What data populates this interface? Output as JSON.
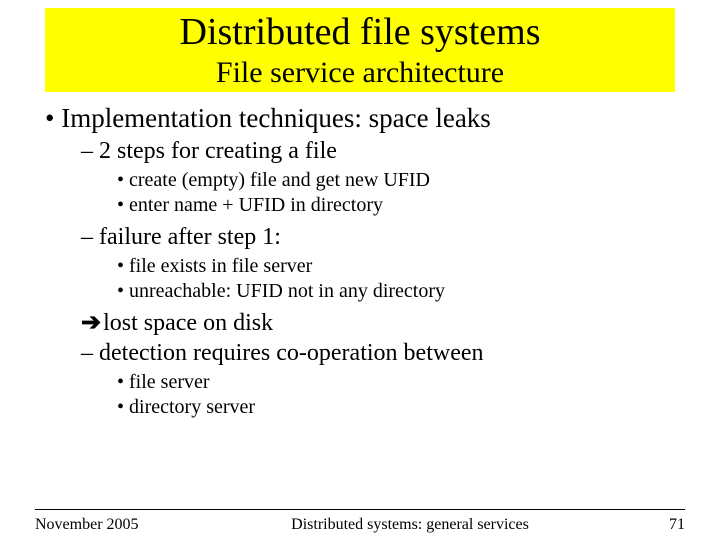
{
  "title": {
    "main": "Distributed file systems",
    "sub": "File service architecture"
  },
  "bullets": {
    "b1": "Implementation techniques:  space leaks",
    "b1_1": "2 steps for creating a file",
    "b1_1_a": "create (empty)  file and get new UFID",
    "b1_1_b": "enter name +  UFID in directory",
    "b1_2": "failure after step 1:",
    "b1_2_a": "file exists in file server",
    "b1_2_b": "unreachable: UFID not in any directory",
    "b1_3": "lost space on disk",
    "b1_4": "detection requires co-operation between",
    "b1_4_a": "file server",
    "b1_4_b": "directory server"
  },
  "footer": {
    "date": "November 2005",
    "center": "Distributed systems: general services",
    "page": "71"
  }
}
